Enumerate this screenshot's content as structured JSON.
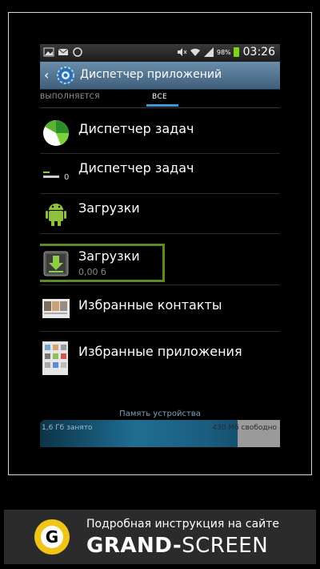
{
  "status": {
    "time": "03:26",
    "battery": "98%"
  },
  "titlebar": {
    "title": "Диспетчер приложений"
  },
  "tabs": {
    "running": "ВЫПОЛНЯЕТСЯ",
    "all": "ВСЕ"
  },
  "apps": [
    {
      "label": "Диспетчер задач",
      "icon": "pie-chart-icon"
    },
    {
      "label": "Диспетчер задач",
      "icon": "task-widget-icon"
    },
    {
      "label": "Загрузки",
      "icon": "android-icon"
    },
    {
      "label": "Загрузки",
      "sub": "0,00 б",
      "icon": "download-icon"
    },
    {
      "label": "Избранные контакты",
      "icon": "contacts-icon"
    },
    {
      "label": "Избранные приложения",
      "icon": "apps-grid-icon"
    }
  ],
  "storage": {
    "title": "Память устройства",
    "used": "1,6 Гб занято",
    "free": "430 Мб свободно"
  },
  "banner": {
    "line1": "Подробная инструкция на сайте",
    "brand_left": "GRAND",
    "brand_dash": "-",
    "brand_right": "SCREEN",
    "logo_letter": "G"
  },
  "colors": {
    "highlight": "#5c8a2c",
    "accent": "#3b98d4",
    "logo": "#f0c419"
  }
}
